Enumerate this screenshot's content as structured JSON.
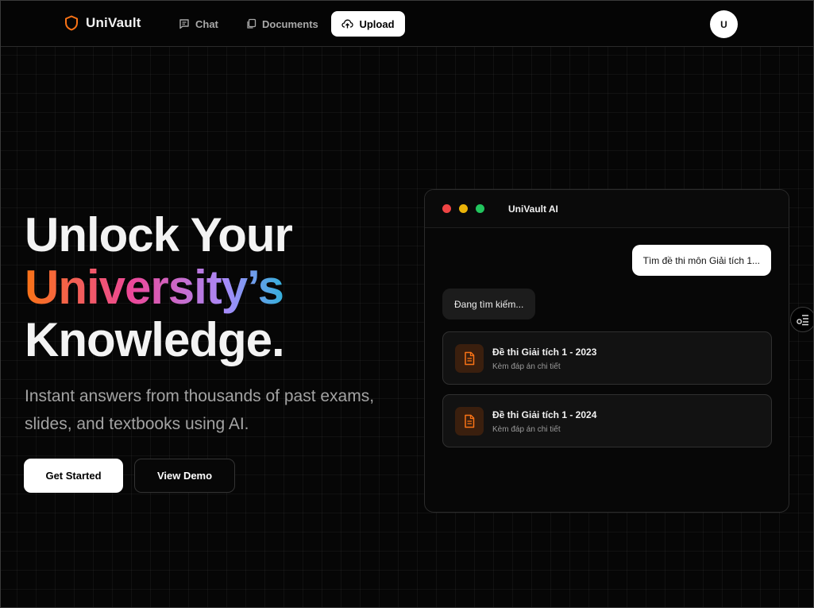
{
  "brand": {
    "name": "UniVault",
    "icon": "shield-icon",
    "accent": "#f97316"
  },
  "nav": {
    "items": [
      {
        "label": "Chat",
        "icon": "chat-icon"
      },
      {
        "label": "Documents",
        "icon": "documents-icon"
      },
      {
        "label": "Upload",
        "icon": "upload-cloud-icon"
      }
    ],
    "avatar": "U"
  },
  "hero": {
    "line1": "Unlock Your",
    "line2": "University’s",
    "line3": "Knowledge.",
    "subtitle": "Instant answers from thousands of past exams, slides, and textbooks using AI.",
    "primary_button": "Get Started",
    "secondary_button": "View Demo"
  },
  "chat_card": {
    "title": "UniVault AI",
    "window_dots": [
      "#ef4444",
      "#eab308",
      "#22c55e"
    ],
    "user_message": "Tìm đề thi môn Giải tích 1...",
    "ai_message": "Đang tìm kiếm...",
    "results": [
      {
        "title": "Đề thi Giải tích 1 - 2023",
        "meta": "Kèm đáp án chi tiết",
        "icon": "document-icon"
      },
      {
        "title": "Đề thi Giải tích 1 - 2024",
        "meta": "Kèm đáp án chi tiết",
        "icon": "document-icon"
      }
    ]
  },
  "side_widget": {
    "icon": "settings-list-icon"
  }
}
